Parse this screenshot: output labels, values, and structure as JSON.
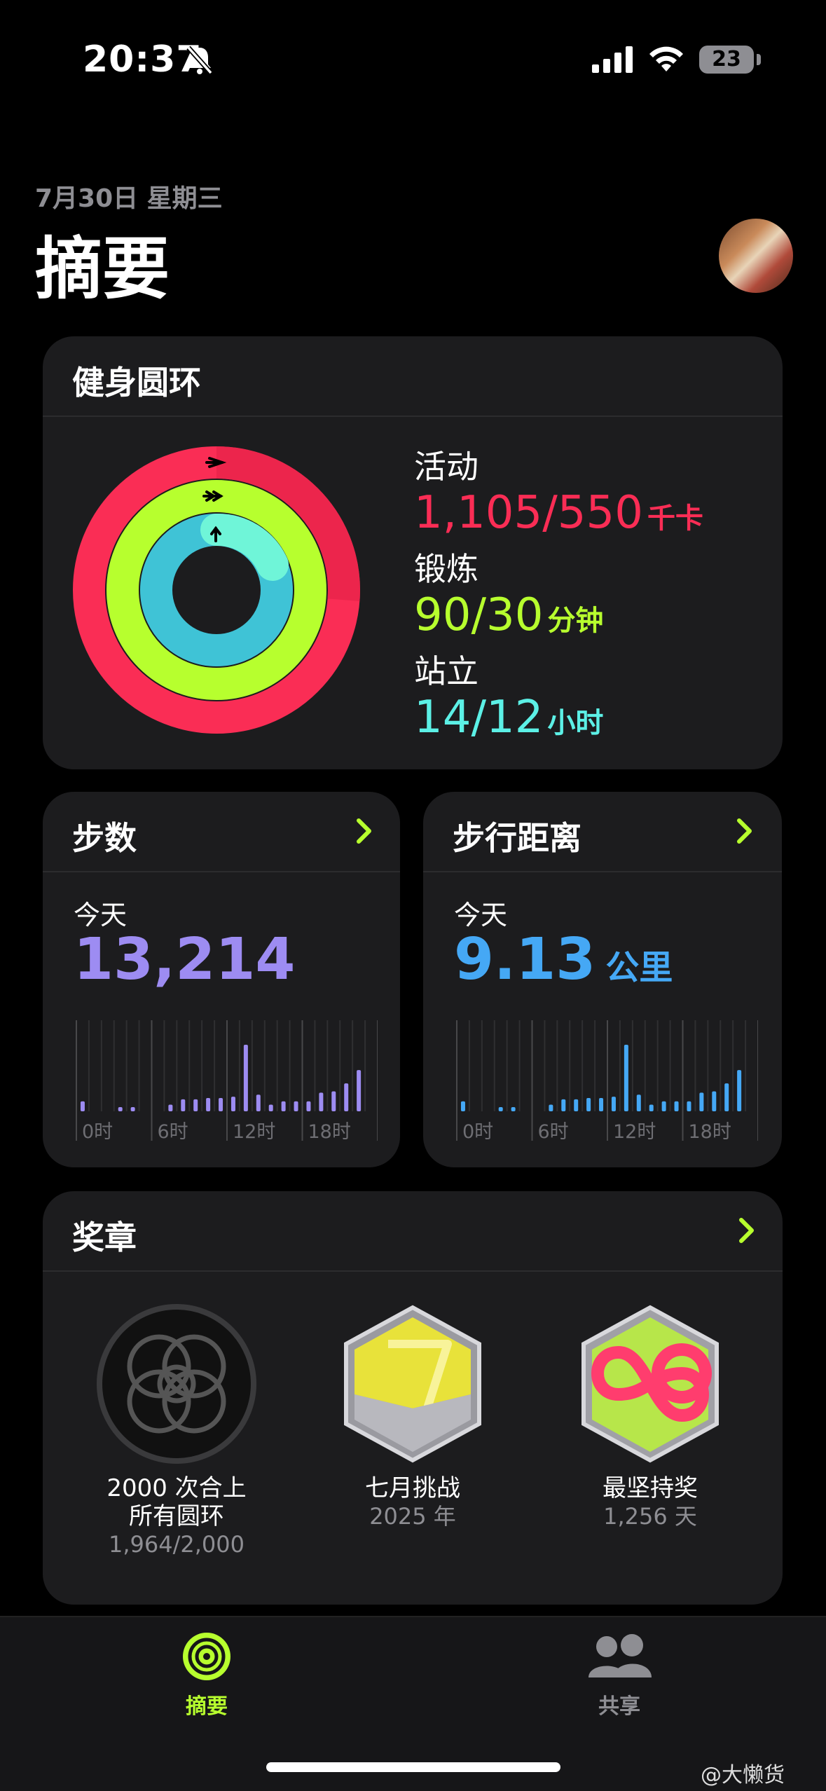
{
  "status_bar": {
    "time": "20:37",
    "battery": "23"
  },
  "header": {
    "date": "7月30日 星期三",
    "title": "摘要"
  },
  "rings_card": {
    "title": "健身圆环",
    "move": {
      "label": "活动",
      "value": "1,105/550",
      "unit": "千卡",
      "color": "#fa2d55"
    },
    "exercise": {
      "label": "锻炼",
      "value": "90/30",
      "unit": "分钟",
      "color": "#b7ff2e"
    },
    "stand": {
      "label": "站立",
      "value": "14/12",
      "unit": "小时",
      "color": "#5cf0e6"
    }
  },
  "steps_card": {
    "title": "步数",
    "today_label": "今天",
    "value": "13,214",
    "accent": "#9d8cf2",
    "axis_labels": [
      "0时",
      "6时",
      "12时",
      "18时"
    ],
    "hourly": [
      0.15,
      0,
      0,
      0.06,
      0.06,
      0,
      0,
      0.1,
      0.18,
      0.18,
      0.2,
      0.2,
      0.22,
      1.0,
      0.25,
      0.1,
      0.15,
      0.15,
      0.15,
      0.28,
      0.3,
      0.42,
      0.62,
      0
    ]
  },
  "distance_card": {
    "title": "步行距离",
    "today_label": "今天",
    "value": "9.13",
    "unit": "公里",
    "accent": "#45a8f5",
    "axis_labels": [
      "0时",
      "6时",
      "12时",
      "18时"
    ],
    "hourly": [
      0.15,
      0,
      0,
      0.06,
      0.06,
      0,
      0,
      0.1,
      0.18,
      0.18,
      0.2,
      0.2,
      0.22,
      1.0,
      0.25,
      0.1,
      0.15,
      0.15,
      0.15,
      0.28,
      0.3,
      0.42,
      0.62,
      0
    ]
  },
  "awards_card": {
    "title": "奖章",
    "items": [
      {
        "name1": "2000 次合上",
        "name2": "所有圆环",
        "sub": "1,964/2,000"
      },
      {
        "name1": "七月挑战",
        "name2": "",
        "sub": "2025 年"
      },
      {
        "name1": "最坚持奖",
        "name2": "",
        "sub": "1,256 天"
      }
    ]
  },
  "tabbar": {
    "summary": {
      "label": "摘要",
      "color": "#b7ff2e"
    },
    "sharing": {
      "label": "共享",
      "color": "#8e8e93"
    }
  },
  "watermark": "@大懒货"
}
